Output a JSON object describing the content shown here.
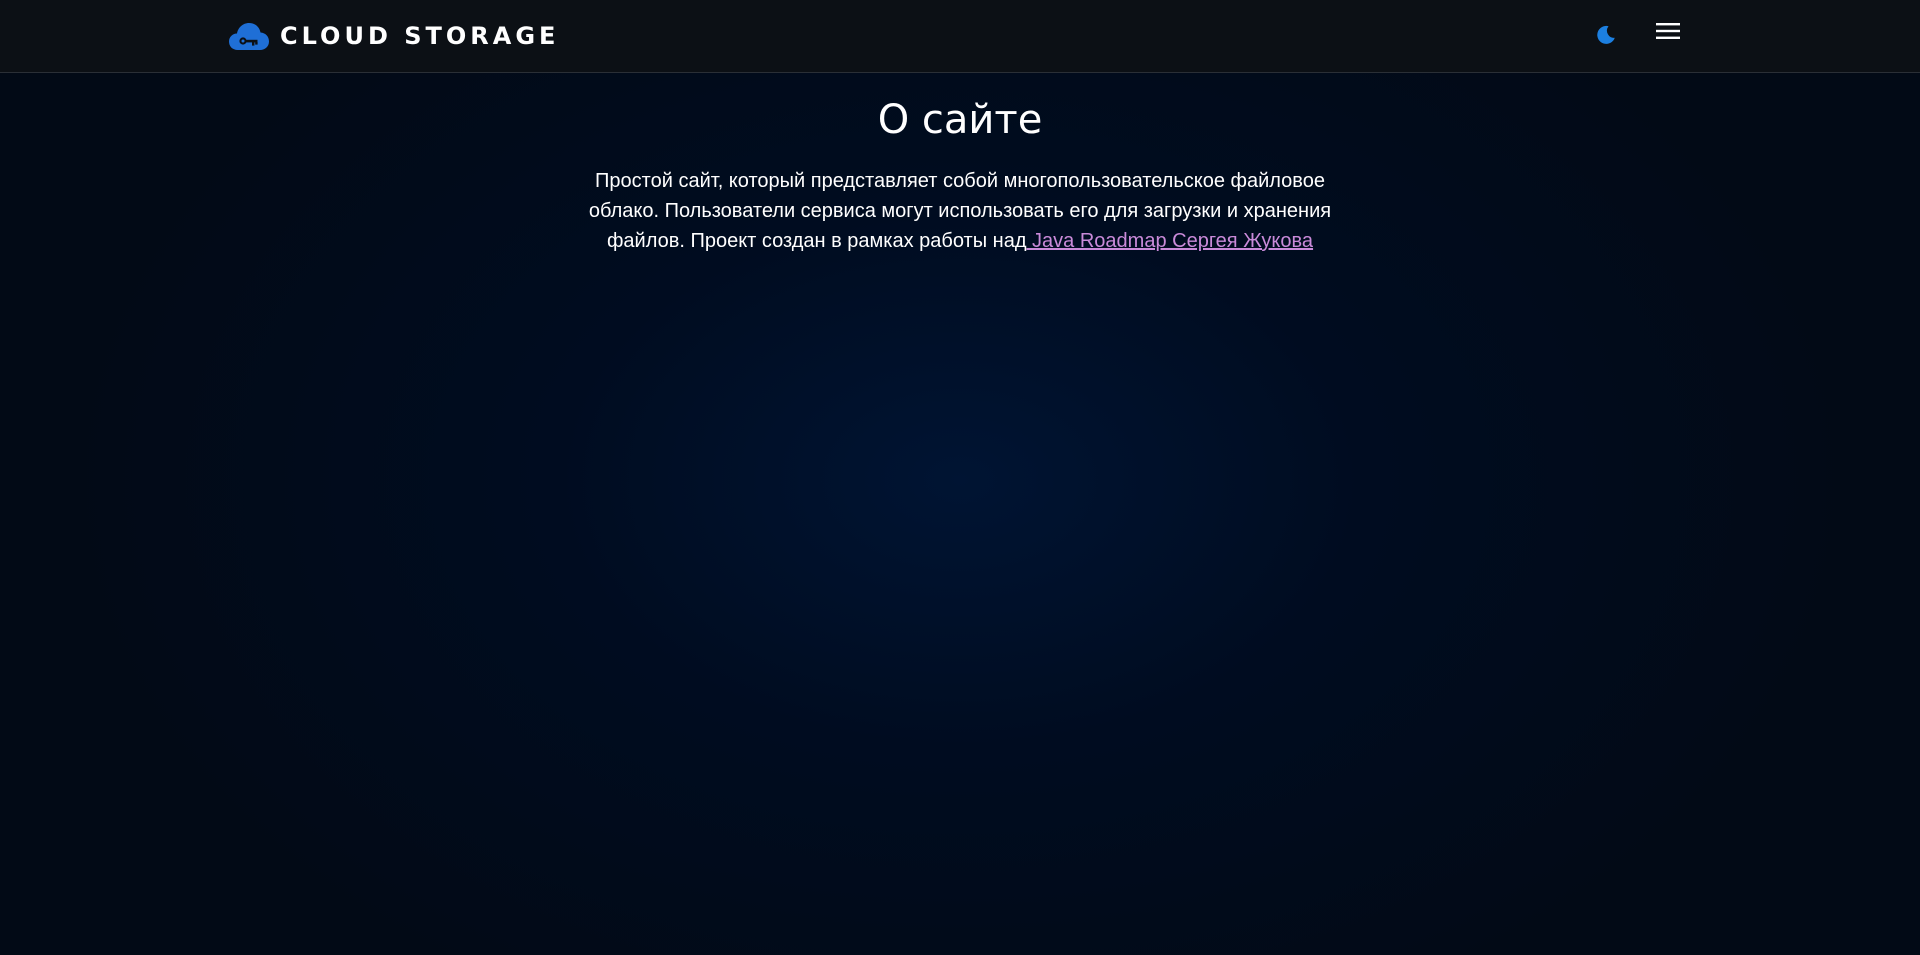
{
  "header": {
    "brand_title": "CLOUD STORAGE",
    "brand_icon": "cloud-key-icon",
    "theme_icon": "moon-icon",
    "menu_icon": "hamburger-menu-icon",
    "accent_color": "#1f6fd6",
    "theme_icon_color": "#1c7fe0"
  },
  "main": {
    "title": "О сайте",
    "description_text": "Простой сайт, который представляет собой многопользовательское файловое облако. Пользователи сервиса могут использовать его для загрузки и хранения файлов. Проект создан в рамках работы над",
    "link_text": " Java Roadmap Сергея Жукова",
    "link_color": "#c98ad9"
  },
  "colors": {
    "background": "#000c20",
    "header_background": "#0c1015",
    "text": "#ffffff"
  }
}
